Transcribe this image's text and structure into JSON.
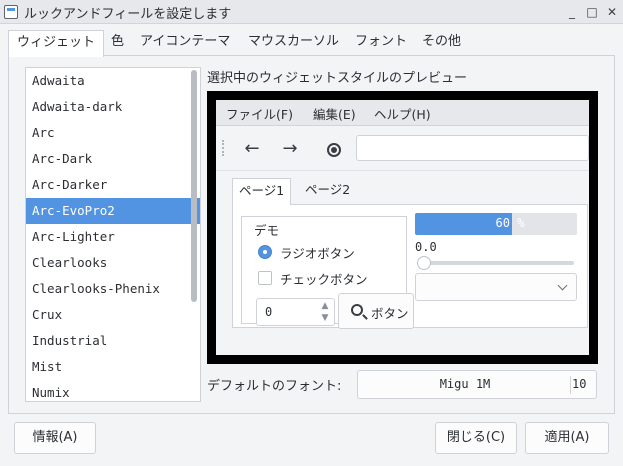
{
  "window": {
    "title": "ルックアンドフィールを設定します",
    "minimize": "_",
    "maximize": "□",
    "close": "✕"
  },
  "tabs": [
    "ウィジェット",
    "色",
    "アイコンテーマ",
    "マウスカーソル",
    "フォント",
    "その他"
  ],
  "themes": {
    "items": [
      "Adwaita",
      "Adwaita-dark",
      "Arc",
      "Arc-Dark",
      "Arc-Darker",
      "Arc-EvoPro2",
      "Arc-Lighter",
      "Clearlooks",
      "Clearlooks-Phenix",
      "Crux",
      "Industrial",
      "Mist",
      "Numix"
    ],
    "selected": "Arc-EvoPro2"
  },
  "preview": {
    "label": "選択中のウィジェットスタイルのプレビュー",
    "menu": [
      "ファイル(F)",
      "編集(E)",
      "ヘルプ(H)"
    ],
    "toolbar": {
      "back": "←",
      "forward": "→"
    },
    "tabs": [
      "ページ1",
      "ページ2"
    ],
    "demo_label": "デモ",
    "radio_label": "ラジオボタン",
    "check_label": "チェックボタン",
    "spin_value": "0",
    "button_label": "ボタン",
    "progress": {
      "value": 0.6,
      "text": "60 %"
    },
    "scale_value": "0.0",
    "accent": "#5294e2"
  },
  "font": {
    "label": "デフォルトのフォント:",
    "name": "Migu 1M",
    "size": "10"
  },
  "buttons": {
    "about": "情報(A)",
    "close": "閉じる(C)",
    "apply": "適用(A)"
  }
}
